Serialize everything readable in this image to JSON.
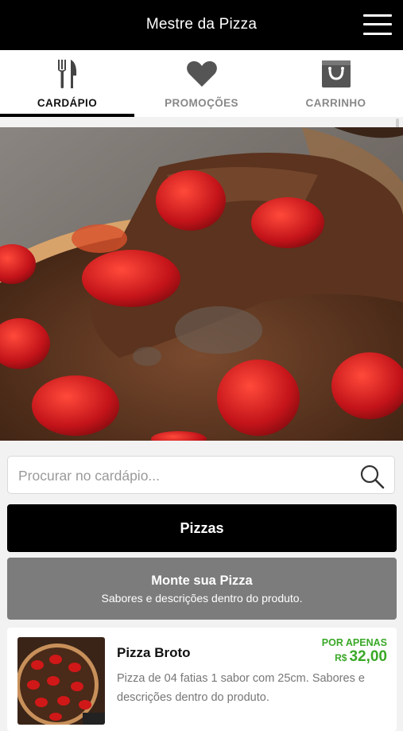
{
  "app": {
    "title": "Mestre da Pizza"
  },
  "tabs": [
    {
      "label": "CARDÁPIO",
      "icon": "fork-knife-icon",
      "active": true
    },
    {
      "label": "PROMOÇÕES",
      "icon": "heart-icon",
      "active": false
    },
    {
      "label": "CARRINHO",
      "icon": "shopping-bag-icon",
      "active": false
    }
  ],
  "search": {
    "placeholder": "Procurar no cardápio..."
  },
  "categories": [
    {
      "label": "Pizzas"
    },
    {
      "label": "Monte sua Pizza",
      "subtitle": "Sabores e descrições dentro do produto."
    }
  ],
  "products": [
    {
      "name": "Pizza Broto",
      "price_prefix": "POR APENAS",
      "currency": "R$",
      "price": "32,00",
      "description": "Pizza de 04 fatias 1 sabor com 25cm. Sabores e descrições dentro do produto."
    }
  ],
  "colors": {
    "header": "#000000",
    "accent_price": "#3aa827",
    "secondary_button": "#7c7c7c"
  }
}
